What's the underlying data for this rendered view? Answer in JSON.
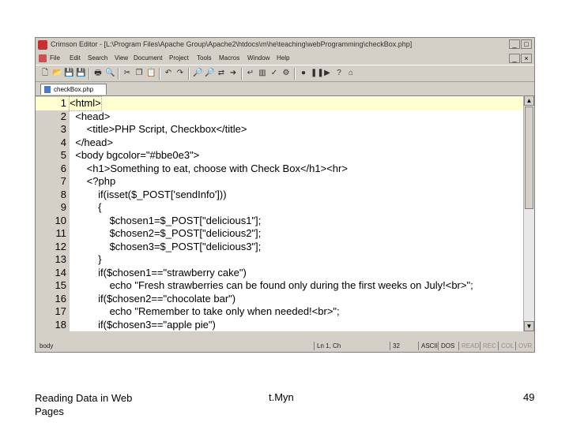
{
  "window": {
    "title": "Crimson Editor - [L:\\Program Files\\Apache Group\\Apache2\\htdocs\\m\\he\\teaching\\webProgramming\\checkBox.php]",
    "minimize_glyph": "_",
    "maximize_glyph": "□",
    "close_glyph": "×"
  },
  "menu": [
    "File",
    "Edit",
    "Search",
    "View",
    "Document",
    "Project",
    "Tools",
    "Macros",
    "Window",
    "Help"
  ],
  "toolbar": {
    "icons": [
      "new-file-icon",
      "open-file-icon",
      "save-icon",
      "save-all-icon",
      "print-icon",
      "print-preview-icon",
      "cut-icon",
      "copy-icon",
      "paste-icon",
      "undo-icon",
      "redo-icon",
      "find-icon",
      "find-next-icon",
      "replace-icon",
      "goto-icon",
      "word-wrap-icon",
      "column-mode-icon",
      "spell-check-icon",
      "settings-icon",
      "record-icon",
      "pause-icon",
      "play-icon",
      "help-icon",
      "home-icon"
    ],
    "glyphs": [
      "🗋",
      "📂",
      "💾",
      "💾",
      "🖶",
      "🔍",
      "✂",
      "❐",
      "📋",
      "↶",
      "↷",
      "🔎",
      "🔎",
      "⇄",
      "➜",
      "↵",
      "▥",
      "✓",
      "⚙",
      "●",
      "❚❚",
      "▶",
      "?",
      "⌂"
    ]
  },
  "tab": {
    "label": "checkBox.php"
  },
  "editor": {
    "lines": [
      {
        "n": "1",
        "text": "<html>"
      },
      {
        "n": "2",
        "text": "  <head>"
      },
      {
        "n": "3",
        "text": "      <title>PHP Script, Checkbox</title>"
      },
      {
        "n": "4",
        "text": "  </head>"
      },
      {
        "n": "5",
        "text": "  <body bgcolor=\"#bbe0e3\">"
      },
      {
        "n": "6",
        "text": "      <h1>Something to eat, choose with Check Box</h1><hr>"
      },
      {
        "n": "7",
        "text": "      <?php"
      },
      {
        "n": "8",
        "text": "          if(isset($_POST['sendInfo']))"
      },
      {
        "n": "9",
        "text": "          {"
      },
      {
        "n": "10",
        "text": "              $chosen1=$_POST[\"delicious1\"];"
      },
      {
        "n": "11",
        "text": "              $chosen2=$_POST[\"delicious2\"];"
      },
      {
        "n": "12",
        "text": "              $chosen3=$_POST[\"delicious3\"];"
      },
      {
        "n": "13",
        "text": "          }"
      },
      {
        "n": "14",
        "text": "          if($chosen1==\"strawberry cake\")"
      },
      {
        "n": "15",
        "text": "              echo \"Fresh strawberries can be found only during the first weeks on July!<br>\";"
      },
      {
        "n": "16",
        "text": "          if($chosen2==\"chocolate bar\")"
      },
      {
        "n": "17",
        "text": "              echo \"Remember to take only when needed!<br>\";"
      },
      {
        "n": "18",
        "text": "          if($chosen3==\"apple pie\")"
      }
    ]
  },
  "status": {
    "context": "body",
    "position": "Ln 1, Ch",
    "column": "32",
    "encoding": "ASCII",
    "line_ending": "DOS",
    "read": "READ",
    "rec": "REC",
    "col": "COL",
    "ovr": "OVR"
  },
  "footer": {
    "left": "Reading Data in Web Pages",
    "middle": "t.Myn",
    "page_number": "49"
  },
  "colors": {
    "window_bg": "#d4d0c8",
    "current_line": "#ffffd0",
    "html_tag": "#000080"
  }
}
